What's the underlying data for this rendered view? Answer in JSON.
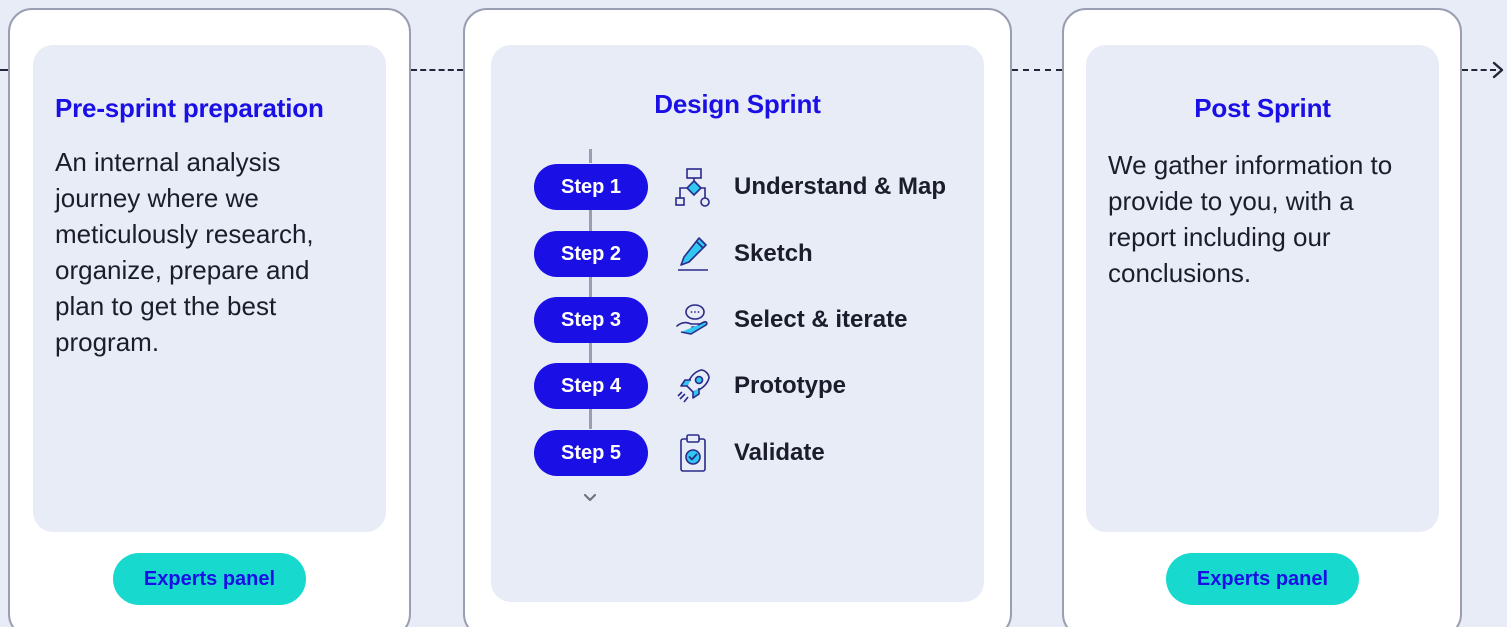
{
  "columns": [
    {
      "title": "Pre-sprint preparation",
      "body": "An internal analysis journey where we meticulously research, organize, prepare and plan to get the best program.",
      "button_label": "Experts panel"
    },
    {
      "title": "Design Sprint",
      "steps": [
        {
          "badge": "Step 1",
          "label": "Understand & Map",
          "icon": "flowchart-icon"
        },
        {
          "badge": "Step 2",
          "label": "Sketch",
          "icon": "pencil-icon"
        },
        {
          "badge": "Step 3",
          "label": "Select & iterate",
          "icon": "hand-speech-bubble-icon"
        },
        {
          "badge": "Step 4",
          "label": "Prototype",
          "icon": "rocket-icon"
        },
        {
          "badge": "Step 5",
          "label": "Validate",
          "icon": "clipboard-check-icon"
        }
      ]
    },
    {
      "title": "Post Sprint",
      "body": "We gather information to provide to you, with a report including our conclusions.",
      "button_label": "Experts panel"
    }
  ],
  "colors": {
    "background": "#e8ecf6",
    "card": "#ffffff",
    "accent": "#1a10e6",
    "button": "#18d9cd",
    "text": "#1b1d2c"
  }
}
